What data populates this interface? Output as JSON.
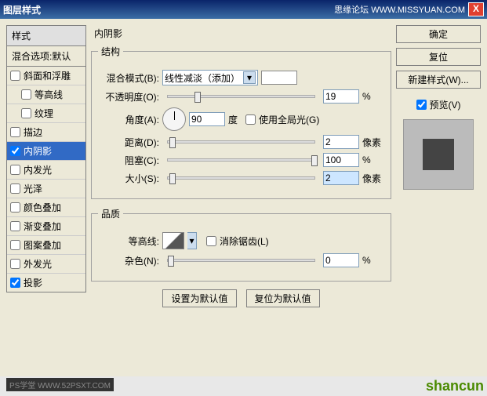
{
  "titlebar": {
    "title": "图层样式",
    "right_text": "思缘论坛  WWW.MISSYUAN.COM",
    "close": "X"
  },
  "left": {
    "header": "样式",
    "blend_default": "混合选项:默认",
    "items": [
      {
        "label": "斜面和浮雕",
        "checked": false
      },
      {
        "label": "等高线",
        "checked": false,
        "indent": true
      },
      {
        "label": "纹理",
        "checked": false,
        "indent": true
      },
      {
        "label": "描边",
        "checked": false
      },
      {
        "label": "内阴影",
        "checked": true,
        "selected": true
      },
      {
        "label": "内发光",
        "checked": false
      },
      {
        "label": "光泽",
        "checked": false
      },
      {
        "label": "颜色叠加",
        "checked": false
      },
      {
        "label": "渐变叠加",
        "checked": false
      },
      {
        "label": "图案叠加",
        "checked": false
      },
      {
        "label": "外发光",
        "checked": false
      },
      {
        "label": "投影",
        "checked": true
      }
    ]
  },
  "panel": {
    "title": "内阴影",
    "structure_legend": "结构",
    "blend_mode_label": "混合模式(B):",
    "blend_mode_value": "线性减淡（添加）",
    "opacity_label": "不透明度(O):",
    "opacity_value": "19",
    "opacity_unit": "%",
    "angle_label": "角度(A):",
    "angle_value": "90",
    "angle_unit": "度",
    "global_light_label": "使用全局光(G)",
    "global_light_checked": false,
    "distance_label": "距离(D):",
    "distance_value": "2",
    "distance_unit": "像素",
    "choke_label": "阻塞(C):",
    "choke_value": "100",
    "choke_unit": "%",
    "size_label": "大小(S):",
    "size_value": "2",
    "size_unit": "像素",
    "quality_legend": "品质",
    "contour_label": "等高线:",
    "antialias_label": "消除锯齿(L)",
    "antialias_checked": false,
    "noise_label": "杂色(N):",
    "noise_value": "0",
    "noise_unit": "%",
    "btn_default": "设置为默认值",
    "btn_reset": "复位为默认值"
  },
  "right": {
    "ok": "确定",
    "cancel": "复位",
    "new_style": "新建样式(W)...",
    "preview_label": "预览(V)",
    "preview_checked": true
  },
  "watermarks": {
    "bl": "PS学堂  WWW.52PSXT.COM",
    "br": "shancun"
  }
}
